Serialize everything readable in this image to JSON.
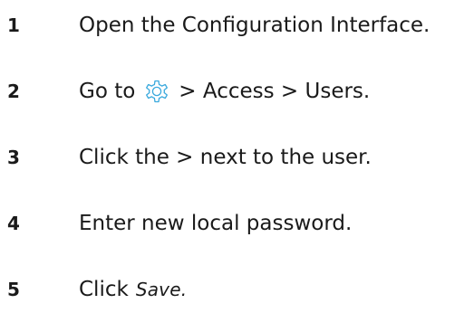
{
  "steps": [
    {
      "number": "1",
      "text": "Open the Configuration Interface."
    },
    {
      "number": "2",
      "prefix": "Go to",
      "icon": "gear-icon",
      "suffix": "> Access > Users."
    },
    {
      "number": "3",
      "text": "Click the > next to the user."
    },
    {
      "number": "4",
      "text": "Enter new local password."
    },
    {
      "number": "5",
      "prefix": "Click",
      "emphasis": "Save."
    }
  ],
  "colors": {
    "text": "#1a1a1a",
    "icon": "#3aa9dd"
  }
}
